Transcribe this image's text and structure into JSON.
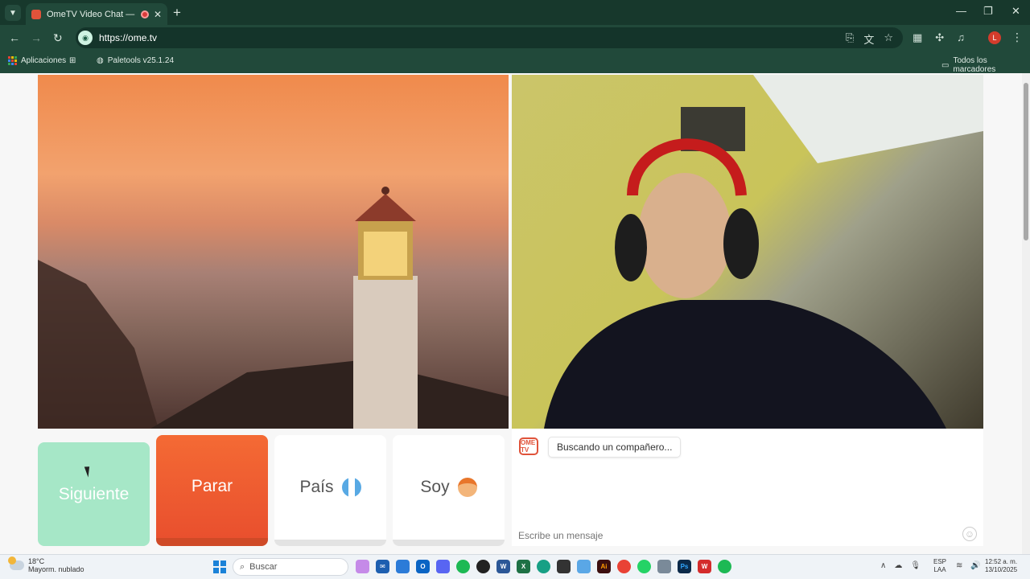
{
  "browser": {
    "tab_title": "OmeTV Video Chat — Omegle",
    "url": "https://ome.tv",
    "bookmarks": [
      {
        "label": "Aplicaciones"
      },
      {
        "label": "Paletools v25.1.24"
      }
    ],
    "all_bookmarks_label": "Todos los marcadores",
    "profile_initial": "L"
  },
  "chat_app": {
    "buttons": {
      "next": "Siguiente",
      "stop": "Parar",
      "country": "País",
      "gender": "Soy"
    },
    "logo_text": "OME TV",
    "status_message": "Buscando un compañero...",
    "message_placeholder": "Escribe un mensaje"
  },
  "taskbar": {
    "weather_temp": "18°C",
    "weather_desc": "Mayorm. nublado",
    "search_placeholder": "Buscar",
    "lang_top": "ESP",
    "lang_bottom": "LAA",
    "time": "12:52 a. m.",
    "date": "13/10/2025"
  }
}
